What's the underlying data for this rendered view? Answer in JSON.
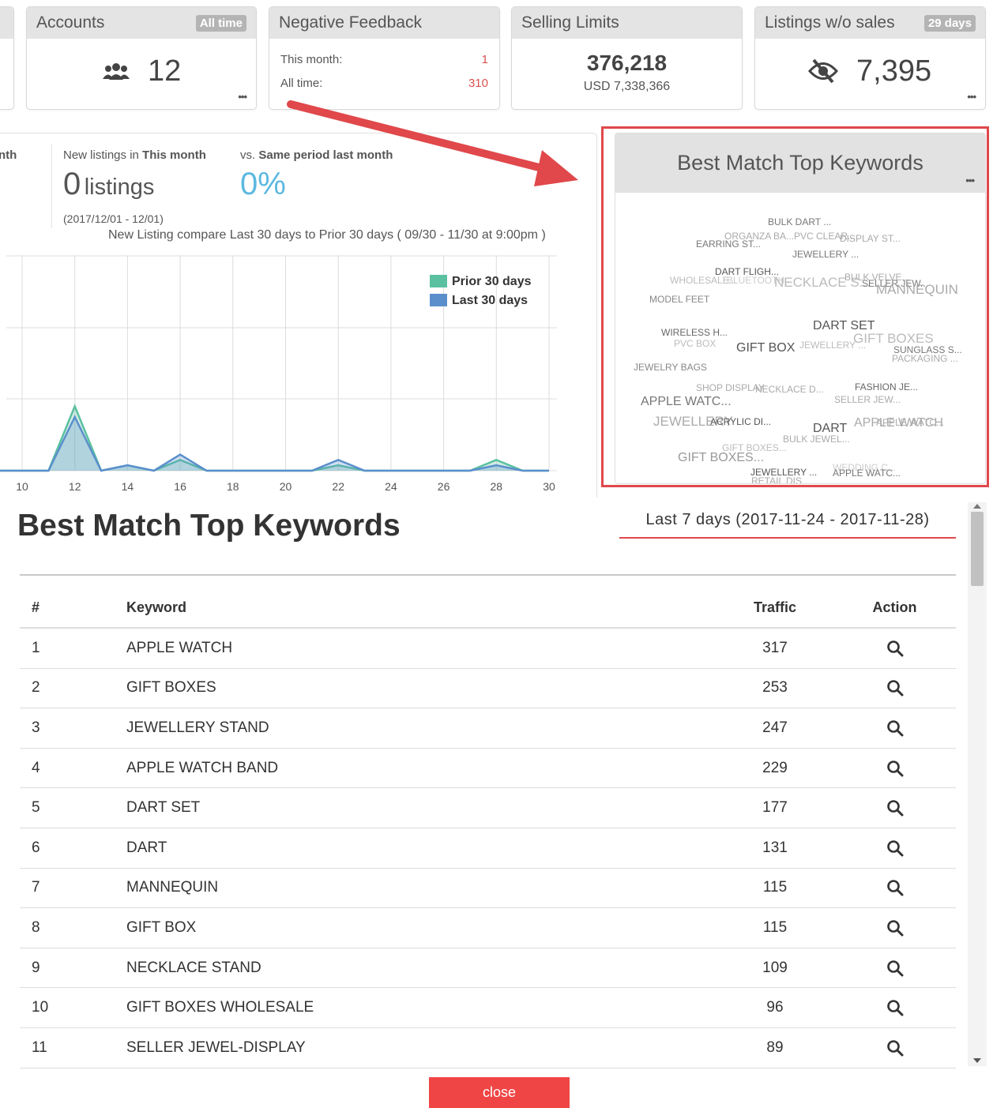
{
  "cards": {
    "accounts": {
      "title": "Accounts",
      "badge": "All time",
      "value": "12",
      "icon": "users-icon"
    },
    "negative_feedback": {
      "title": "Negative Feedback",
      "rows": [
        {
          "label": "This month:",
          "value": "1"
        },
        {
          "label": "All time:",
          "value": "310"
        }
      ]
    },
    "selling_limits": {
      "title": "Selling Limits",
      "value": "376,218",
      "sub": "USD 7,338,366"
    },
    "listings_wo_sales": {
      "title": "Listings w/o sales",
      "badge": "29 days",
      "value": "7,395",
      "icon": "eye-slash-icon"
    },
    "more_label": "•••"
  },
  "listings_panel": {
    "left_label": "nth",
    "new_listings_prefix": "New listings in",
    "new_listings_period": "This month",
    "count": "0",
    "count_unit": "listings",
    "vs_prefix": "vs.",
    "vs_period": "Same period last month",
    "vs_value": "0%",
    "date_range": "(2017/12/01 - 12/01)",
    "compare_text": "New Listing compare Last 30 days to Prior 30 days ( 09/30 - 11/30 at 9:00pm )"
  },
  "chart_data": {
    "type": "area",
    "x": [
      9,
      10,
      11,
      12,
      13,
      14,
      15,
      16,
      17,
      18,
      19,
      20,
      21,
      22,
      23,
      24,
      25,
      26,
      27,
      28,
      29,
      30
    ],
    "tick_labels": [
      "10",
      "12",
      "14",
      "16",
      "18",
      "20",
      "22",
      "24",
      "26",
      "28",
      "30"
    ],
    "series": [
      {
        "name": "Prior 30 days",
        "color": "#5bc0a0",
        "values": [
          0,
          0,
          0,
          12,
          0,
          1,
          0,
          2,
          0,
          0,
          0,
          0,
          0,
          1,
          0,
          0,
          0,
          0,
          0,
          2,
          0,
          0
        ]
      },
      {
        "name": "Last 30 days",
        "color": "#5b8fcc",
        "values": [
          0,
          0,
          0,
          10,
          0,
          1,
          0,
          3,
          0,
          0,
          0,
          0,
          0,
          2,
          0,
          0,
          0,
          0,
          0,
          1,
          0,
          0
        ]
      }
    ],
    "ylim": [
      0,
      40
    ],
    "grid": true,
    "legend": "top-right"
  },
  "keyword_card": {
    "title": "Best Match Top Keywords",
    "cloud": [
      {
        "t": "BULK DART ...",
        "c": "#777"
      },
      {
        "t": "ORGANZA BA...",
        "c": "#aaa"
      },
      {
        "t": "EARRING ST...",
        "c": "#777"
      },
      {
        "t": "PVC CLEAR...",
        "c": "#aaa"
      },
      {
        "t": "DISPLAY ST...",
        "c": "#aaa"
      },
      {
        "t": "JEWELLERY ...",
        "c": "#777"
      },
      {
        "t": "DART FLIGH...",
        "c": "#555"
      },
      {
        "t": "WHOLESALE...",
        "c": "#bbb"
      },
      {
        "t": "BLUETOOTH...",
        "c": "#ccc"
      },
      {
        "t": "NECKLACE S...",
        "c": "#bbb"
      },
      {
        "t": "BULK VELVE...",
        "c": "#aaa"
      },
      {
        "t": "SELLER JEW...",
        "c": "#777"
      },
      {
        "t": "MANNEQUIN",
        "c": "#aaa"
      },
      {
        "t": "MODEL FEET",
        "c": "#888"
      },
      {
        "t": "DART SET",
        "c": "#555"
      },
      {
        "t": "WIRELESS H...",
        "c": "#666"
      },
      {
        "t": "GIFT BOXES",
        "c": "#bbb"
      },
      {
        "t": "PVC BOX",
        "c": "#bbb"
      },
      {
        "t": "GIFT BOX",
        "c": "#555"
      },
      {
        "t": "JEWELLERY ...",
        "c": "#bbb"
      },
      {
        "t": "SUNGLASS S...",
        "c": "#777"
      },
      {
        "t": "PACKAGING ...",
        "c": "#aaa"
      },
      {
        "t": "JEWELRY BAGS",
        "c": "#888"
      },
      {
        "t": "SHOP DISPLAY",
        "c": "#aaa"
      },
      {
        "t": "NECKLACE D...",
        "c": "#aaa"
      },
      {
        "t": "FASHION JE...",
        "c": "#666"
      },
      {
        "t": "APPLE WATC...",
        "c": "#777"
      },
      {
        "t": "SELLER JEW...",
        "c": "#aaa"
      },
      {
        "t": "JEWELLERY",
        "c": "#aaa"
      },
      {
        "t": "ACRYLIC DI...",
        "c": "#555"
      },
      {
        "t": "DART",
        "c": "#555"
      },
      {
        "t": "APPLE WATCH",
        "c": "#aaa"
      },
      {
        "t": "APPLE WATC...",
        "c": "#aaa"
      },
      {
        "t": "BULK JEWEL...",
        "c": "#aaa"
      },
      {
        "t": "GIFT BOXES...",
        "c": "#bbb"
      },
      {
        "t": "GIFT BOXES...",
        "c": "#999"
      },
      {
        "t": "JEWELLERY ...",
        "c": "#555"
      },
      {
        "t": "WEDDING C...",
        "c": "#ccc"
      },
      {
        "t": "APPLE WATC...",
        "c": "#777"
      },
      {
        "t": "RETAIL DIS...",
        "c": "#aaa"
      }
    ]
  },
  "modal": {
    "title": "Best Match Top Keywords",
    "date_range": "Last 7 days (2017-11-24 - 2017-11-28)",
    "columns": [
      "#",
      "Keyword",
      "Traffic",
      "Action"
    ],
    "rows": [
      {
        "n": "1",
        "keyword": "APPLE WATCH",
        "traffic": "317"
      },
      {
        "n": "2",
        "keyword": "GIFT BOXES",
        "traffic": "253"
      },
      {
        "n": "3",
        "keyword": "JEWELLERY STAND",
        "traffic": "247"
      },
      {
        "n": "4",
        "keyword": "APPLE WATCH BAND",
        "traffic": "229"
      },
      {
        "n": "5",
        "keyword": "DART SET",
        "traffic": "177"
      },
      {
        "n": "6",
        "keyword": "DART",
        "traffic": "131"
      },
      {
        "n": "7",
        "keyword": "MANNEQUIN",
        "traffic": "115"
      },
      {
        "n": "8",
        "keyword": "GIFT BOX",
        "traffic": "115"
      },
      {
        "n": "9",
        "keyword": "NECKLACE STAND",
        "traffic": "109"
      },
      {
        "n": "10",
        "keyword": "GIFT BOXES WHOLESALE",
        "traffic": "96"
      },
      {
        "n": "11",
        "keyword": "SELLER JEWEL-DISPLAY",
        "traffic": "89"
      }
    ],
    "action_icon": "search-icon",
    "close_label": "close"
  },
  "colors": {
    "accent_red": "#e0484b",
    "close_button": "#f04545",
    "percent_blue": "#5bb8e0"
  }
}
